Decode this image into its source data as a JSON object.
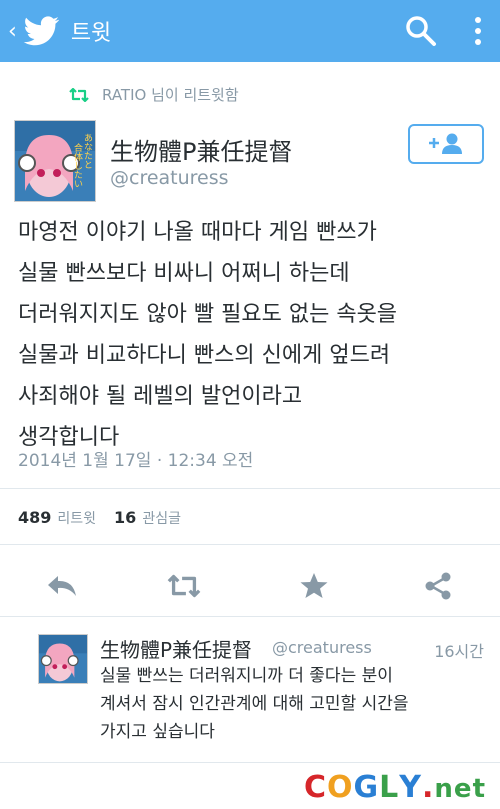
{
  "topbar": {
    "back_glyph": "‹",
    "title": "트윗",
    "icons": [
      "twitter-bird-icon",
      "search-icon",
      "more-vertical-icon"
    ],
    "color": "#55acee"
  },
  "retweet_context": {
    "text": "RATIO 님이 리트윗함",
    "icon": "retweet-icon"
  },
  "tweet": {
    "author_name": "生物體P兼任提督",
    "author_handle": "@creaturess",
    "follow_icon": "add-user-icon",
    "body_lines": [
      "마영전 이야기 나올 때마다 게임 빤쓰가",
      "실물 빤쓰보다 비싸니 어쩌니 하는데",
      "더러워지지도 않아 빨 필요도 없는 속옷을",
      "실물과 비교하다니 빤스의 신에게 엎드려",
      "사죄해야 될 레벨의 발언이라고",
      "생각합니다"
    ],
    "date": "2014년 1월 17일 · 12:34 오전",
    "stats": {
      "retweets_count": "489",
      "retweets_label": "리트윗",
      "favorites_count": "16",
      "favorites_label": "관심글"
    },
    "actions": [
      "reply-icon",
      "retweet-icon",
      "favorite-star-icon",
      "share-icon"
    ]
  },
  "reply": {
    "author_name": "生物體P兼任提督",
    "author_handle": "@creaturess",
    "time": "16시간",
    "body_lines": [
      "실물 빤쓰는 더러워지니까 더 좋다는 분이",
      "계셔서 잠시 인간관계에 대해 고민할 시간을",
      "가지고 싶습니다"
    ]
  },
  "watermark": {
    "letters": [
      "C",
      "O",
      "G",
      "L",
      "Y"
    ],
    "dot": ".",
    "suffix": "net"
  },
  "avatar_text": [
    "あなたと",
    "合体したい"
  ]
}
